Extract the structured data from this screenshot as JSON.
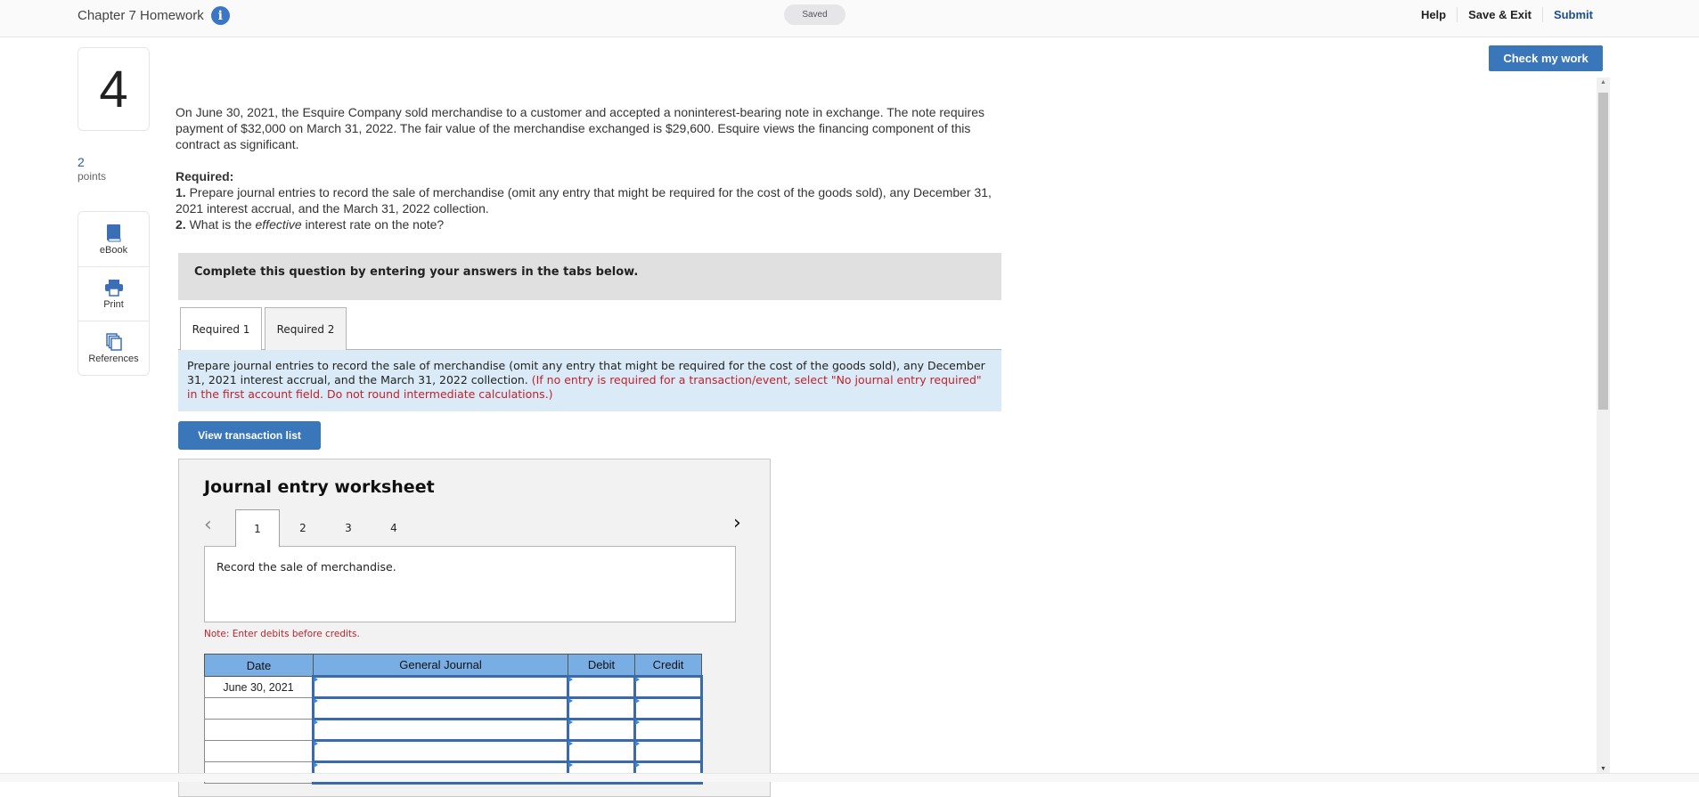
{
  "header": {
    "title": "Chapter 7 Homework",
    "info_icon": "info-icon",
    "saved_status": "Saved",
    "links": {
      "help": "Help",
      "save_exit": "Save & Exit",
      "submit": "Submit"
    }
  },
  "check_my_work": "Check my work",
  "question": {
    "number": "4",
    "points_value": "2",
    "points_label": "points",
    "tools": [
      {
        "label": "eBook",
        "icon": "book-icon"
      },
      {
        "label": "Print",
        "icon": "printer-icon"
      },
      {
        "label": "References",
        "icon": "copy-documents-icon"
      }
    ],
    "body": "On June 30, 2021, the Esquire Company sold merchandise to a customer and accepted a noninterest-bearing note in exchange. The note requires payment of $32,000 on March 31, 2022. The fair value of the merchandise exchanged is $29,600. Esquire views the financing component of this contract as significant.",
    "required_heading": "Required:",
    "req1_num": "1.",
    "req1_text": " Prepare journal entries to record the sale of merchandise (omit any entry that might be required for the cost of the goods sold), any December 31, 2021 interest accrual, and the March 31, 2022 collection.",
    "req2_num": "2.",
    "req2_pre": " What is the ",
    "req2_em": "effective",
    "req2_post": " interest rate on the note?"
  },
  "complete_banner": "Complete this question by entering your answers in the tabs below.",
  "tabs": [
    {
      "label": "Required 1",
      "active": true
    },
    {
      "label": "Required 2",
      "active": false
    }
  ],
  "instructions": {
    "text": "Prepare journal entries to record the sale of merchandise (omit any entry that might be required for the cost of the goods sold), any December 31, 2021 interest accrual, and the March 31, 2022 collection. ",
    "red_text": "(If no entry is required for a transaction/event, select \"No journal entry required\" in the first account field. Do not round intermediate calculations.)"
  },
  "view_transaction_list": "View transaction list",
  "worksheet": {
    "title": "Journal entry worksheet",
    "pages": [
      "1",
      "2",
      "3",
      "4"
    ],
    "active_page": "1",
    "description": "Record the sale of merchandise.",
    "note": "Note: Enter debits before credits.",
    "columns": [
      "Date",
      "General Journal",
      "Debit",
      "Credit"
    ],
    "rows": [
      {
        "date": "June 30, 2021",
        "account": "",
        "debit": "",
        "credit": ""
      },
      {
        "date": "",
        "account": "",
        "debit": "",
        "credit": ""
      },
      {
        "date": "",
        "account": "",
        "debit": "",
        "credit": ""
      },
      {
        "date": "",
        "account": "",
        "debit": "",
        "credit": ""
      },
      {
        "date": "",
        "account": "",
        "debit": "",
        "credit": ""
      }
    ]
  },
  "colors": {
    "accent_blue": "#3a76ba",
    "submit_link": "#1b4e8c",
    "instruction_red": "#c0222b",
    "table_header": "#79aee5",
    "instruction_bg": "#daeaf7"
  }
}
